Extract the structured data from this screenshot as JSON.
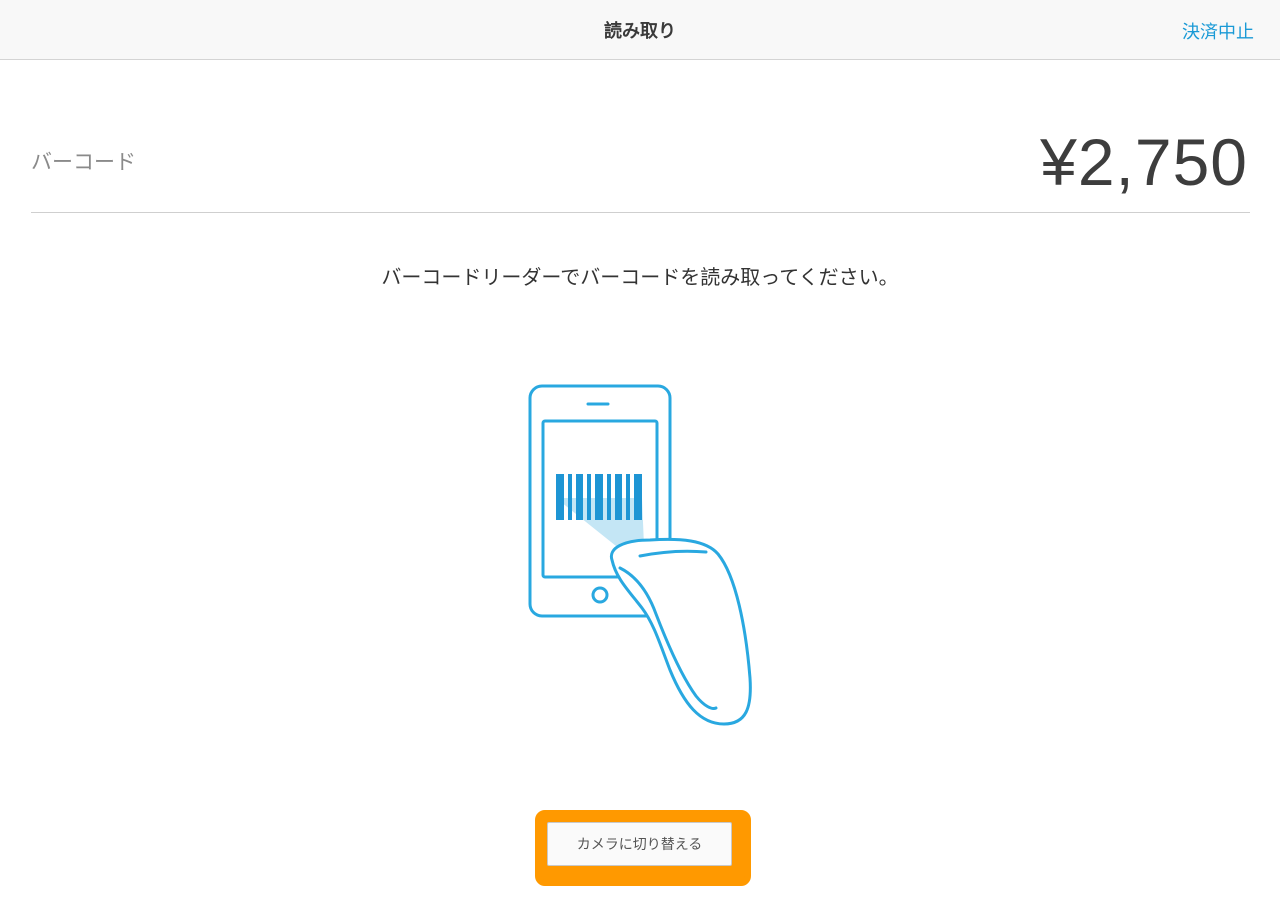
{
  "nav": {
    "title": "読み取り",
    "cancel_label": "決済中止"
  },
  "payment": {
    "method_label": "バーコード",
    "amount": "¥2,750"
  },
  "instruction": "バーコードリーダーでバーコードを読み取ってください。",
  "illustration": {
    "icon": "barcode-scanner-icon",
    "accent_color": "#29a8e0"
  },
  "switch_camera_button": {
    "label": "カメラに切り替える"
  },
  "colors": {
    "accent": "#1a9ad6",
    "highlight": "#ff9900"
  }
}
